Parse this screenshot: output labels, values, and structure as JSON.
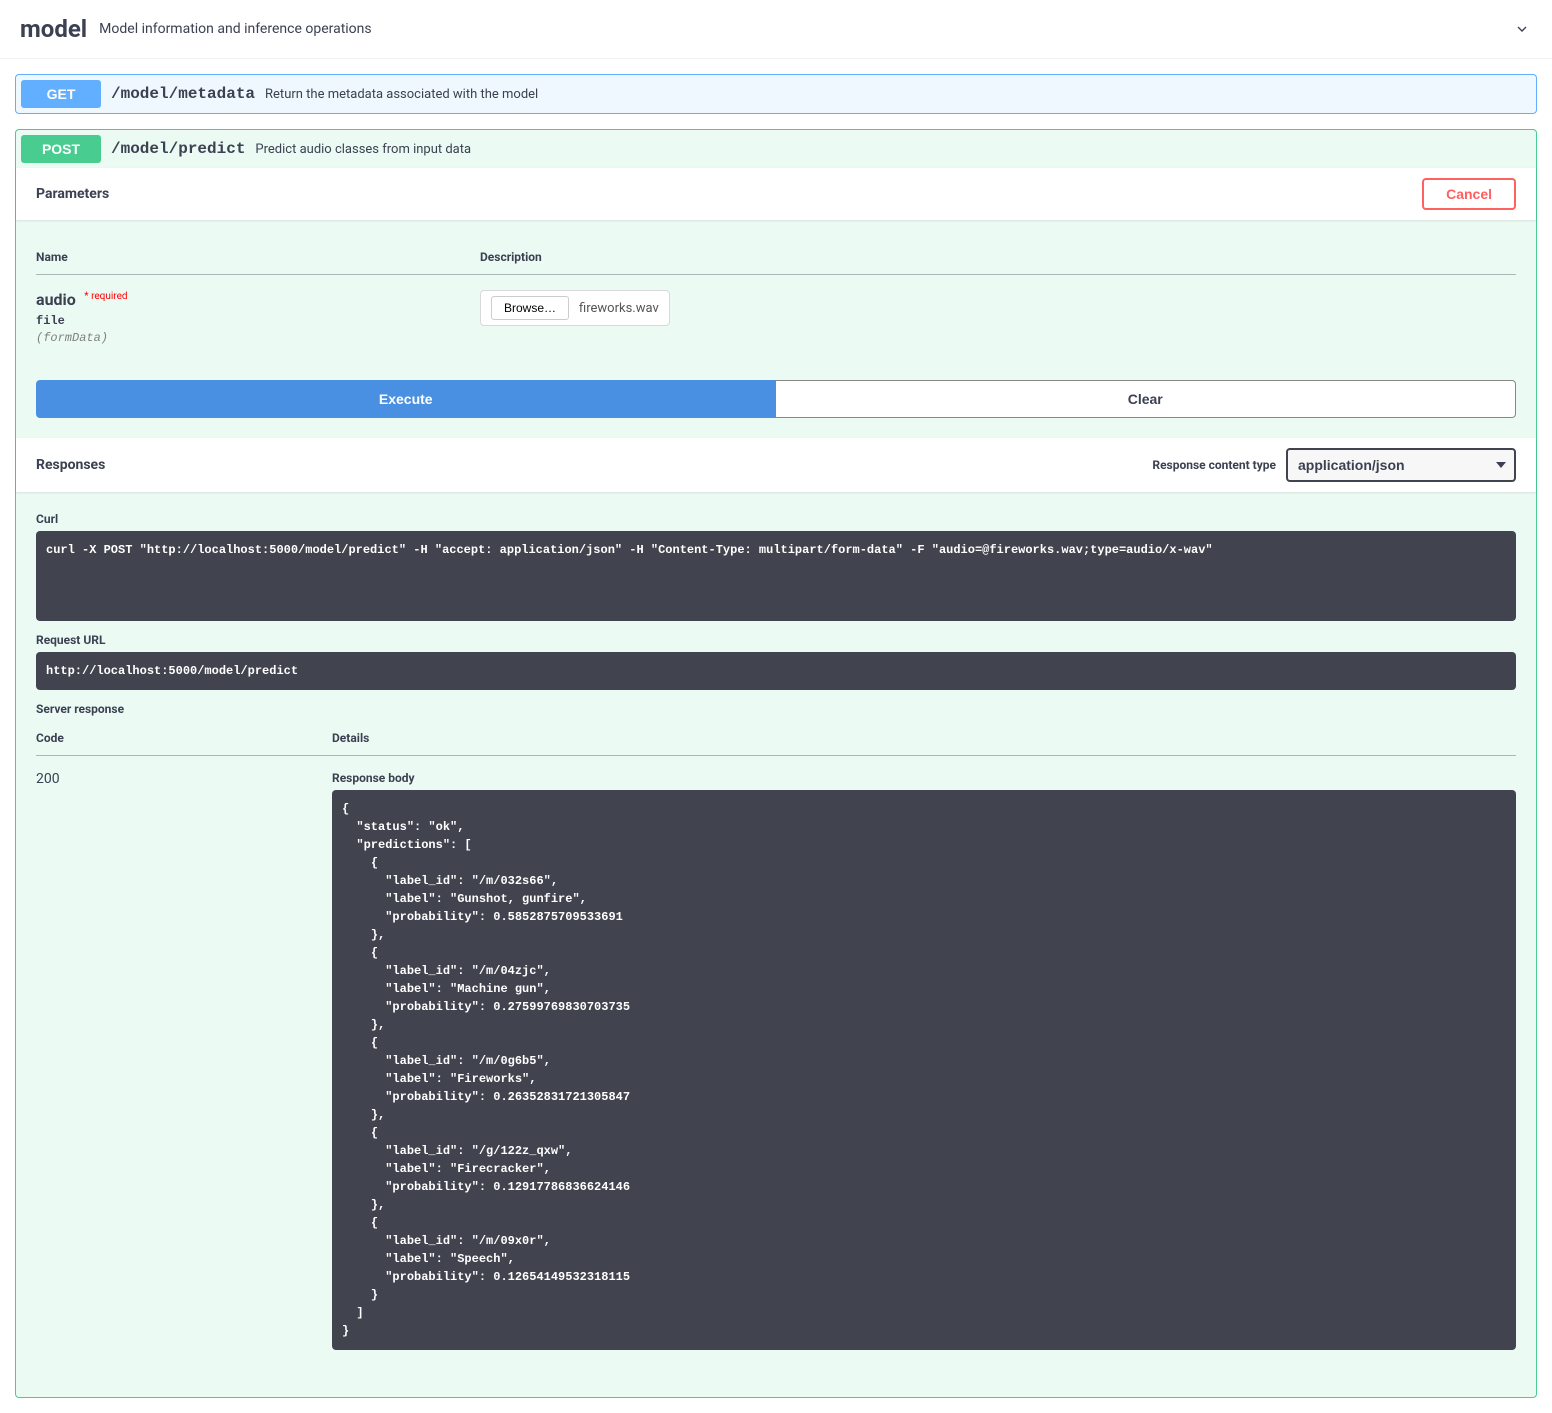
{
  "tag": {
    "name": "model",
    "description": "Model information and inference operations"
  },
  "ops": {
    "get": {
      "method": "GET",
      "path": "/model/metadata",
      "summary": "Return the metadata associated with the model"
    },
    "post": {
      "method": "POST",
      "path": "/model/predict",
      "summary": "Predict audio classes from input data"
    }
  },
  "parameters": {
    "title": "Parameters",
    "cancel": "Cancel",
    "cols": {
      "name": "Name",
      "description": "Description"
    },
    "param": {
      "name": "audio",
      "required": "* required",
      "type": "file",
      "in": "(formData)",
      "browse": "Browse…",
      "filename": "fireworks.wav"
    }
  },
  "actions": {
    "execute": "Execute",
    "clear": "Clear"
  },
  "responses": {
    "title": "Responses",
    "content_type_label": "Response content type",
    "content_type": "application/json",
    "curl_label": "Curl",
    "curl": "curl -X POST \"http://localhost:5000/model/predict\" -H \"accept: application/json\" -H \"Content-Type: multipart/form-data\" -F \"audio=@fireworks.wav;type=audio/x-wav\"",
    "request_url_label": "Request URL",
    "request_url": "http://localhost:5000/model/predict",
    "server_response_label": "Server response",
    "cols": {
      "code": "Code",
      "details": "Details"
    },
    "code": "200",
    "body_label": "Response body",
    "body": "{\n  \"status\": \"ok\",\n  \"predictions\": [\n    {\n      \"label_id\": \"/m/032s66\",\n      \"label\": \"Gunshot, gunfire\",\n      \"probability\": 0.5852875709533691\n    },\n    {\n      \"label_id\": \"/m/04zjc\",\n      \"label\": \"Machine gun\",\n      \"probability\": 0.27599769830703735\n    },\n    {\n      \"label_id\": \"/m/0g6b5\",\n      \"label\": \"Fireworks\",\n      \"probability\": 0.26352831721305847\n    },\n    {\n      \"label_id\": \"/g/122z_qxw\",\n      \"label\": \"Firecracker\",\n      \"probability\": 0.12917786836624146\n    },\n    {\n      \"label_id\": \"/m/09x0r\",\n      \"label\": \"Speech\",\n      \"probability\": 0.12654149532318115\n    }\n  ]\n}"
  }
}
